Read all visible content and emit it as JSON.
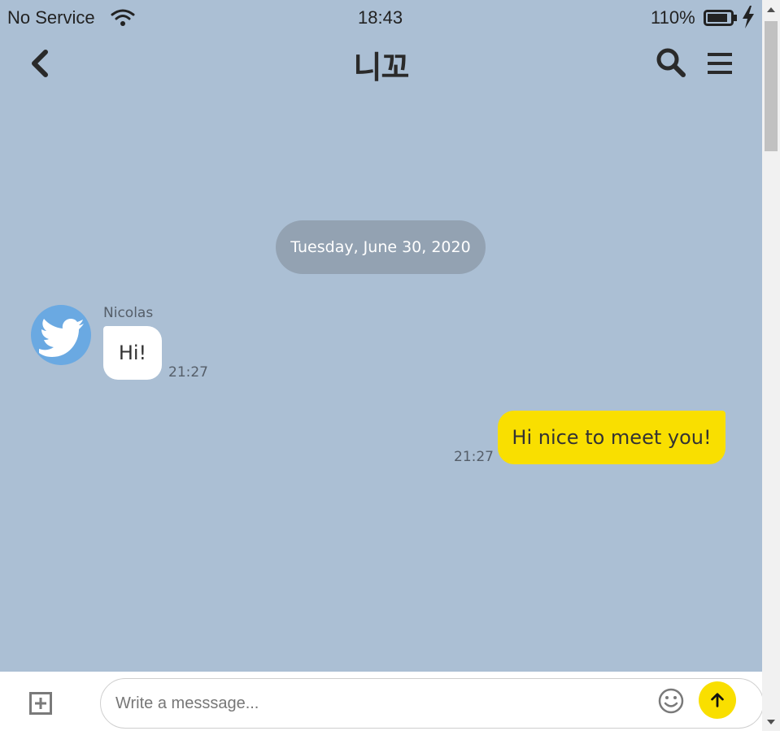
{
  "status_bar": {
    "carrier": "No Service",
    "time": "18:43",
    "battery_percent": "110%",
    "icons": [
      "wifi-icon",
      "battery-icon",
      "charging-bolt-icon"
    ]
  },
  "header": {
    "title": "니꼬",
    "icons": [
      "chevron-left-icon",
      "search-icon",
      "hamburger-menu-icon"
    ]
  },
  "chat": {
    "date_divider": "Tuesday, June 30, 2020",
    "messages": [
      {
        "direction": "received",
        "sender": "Nicolas",
        "avatar_icon": "twitter-bird-icon",
        "text": "Hi!",
        "time": "21:27"
      },
      {
        "direction": "sent",
        "text": "Hi nice to meet you!",
        "time": "21:27"
      }
    ]
  },
  "composer": {
    "placeholder": "Write a messsage...",
    "value": "",
    "icons": [
      "plus-square-icon",
      "smiley-icon",
      "arrow-up-icon"
    ]
  },
  "colors": {
    "chat_background": "#abbfd4",
    "sent_bubble": "#f9df00",
    "received_bubble": "#ffffff",
    "date_pill": "#93a2b2",
    "send_button": "#f9df00",
    "avatar": "#6aa9e2"
  }
}
